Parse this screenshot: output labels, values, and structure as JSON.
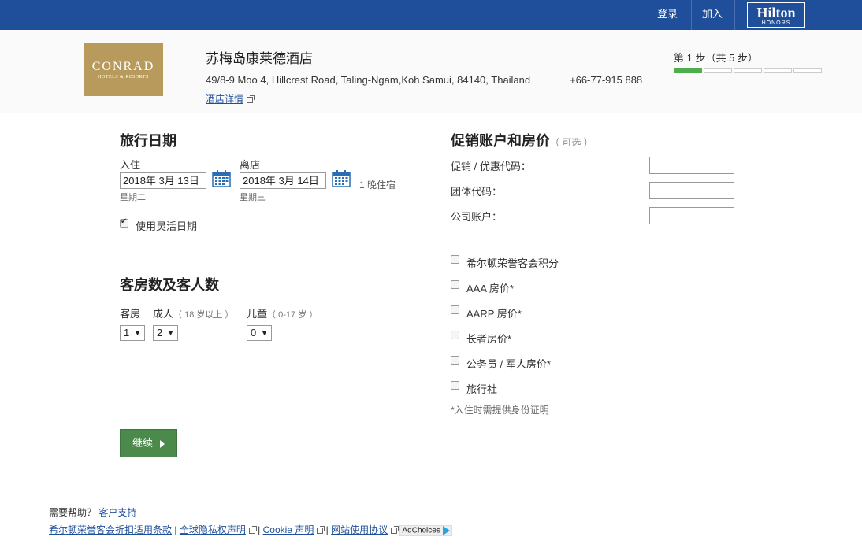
{
  "topbar": {
    "login_label": "登录",
    "join_label": "加入",
    "logo_brand": "Hilton",
    "logo_sub": "HONORS",
    "bg_color": "#1f4f9a"
  },
  "hotel": {
    "logo_name": "CONRAD",
    "logo_sub": "HOTELS & RESORTS",
    "name": "苏梅岛康莱德酒店",
    "address": "49/8-9 Moo 4, Hillcrest Road, Taling-Ngam,Koh Samui, 84140, Thailand",
    "phone": "+66-77-915 888",
    "details_link": "酒店详情"
  },
  "progress": {
    "label": "第 1 步（共 5 步）",
    "current_step": 1,
    "total_steps": 5,
    "active_color": "#4cae4c"
  },
  "travel_dates": {
    "heading": "旅行日期",
    "checkin_label": "入住",
    "checkin_value": "2018年 3月 13日",
    "checkin_weekday": "星期二",
    "checkout_label": "离店",
    "checkout_value": "2018年 3月 14日",
    "checkout_weekday": "星期三",
    "nights": "1 晚住宿",
    "flexible_label": "使用灵活日期",
    "flexible_checked": true
  },
  "rooms_guests": {
    "heading": "客房数及客人数",
    "rooms_label": "客房",
    "adults_label": "成人",
    "adults_note": "（ 18 岁以上 ）",
    "children_label": "儿童",
    "children_note": "（ 0-17 岁 ）",
    "rooms_value": "1",
    "adults_value": "2",
    "children_value": "0"
  },
  "promo": {
    "heading": "促销账户和房价",
    "optional": "（ 可选 ）",
    "promo_code_label": "促销 / 优惠代码：",
    "group_code_label": "团体代码：",
    "corporate_label": "公司账户：",
    "options": [
      {
        "label": "希尔顿荣誉客会积分"
      },
      {
        "label": "AAA 房价*"
      },
      {
        "label": "AARP 房价*"
      },
      {
        "label": "长者房价*"
      },
      {
        "label": "公务员 / 军人房价*"
      },
      {
        "label": "旅行社"
      }
    ],
    "note": "*入住时需提供身份证明"
  },
  "continue_label": "继续",
  "footer": {
    "help_label": "需要帮助？",
    "support_link": "客户支持",
    "terms_link": "希尔顿荣誉客会折扣适用条款",
    "privacy_link": "全球隐私权声明",
    "cookie_link": "Cookie 声明",
    "site_terms_link": "网站使用协议",
    "adchoices": "AdChoices"
  }
}
